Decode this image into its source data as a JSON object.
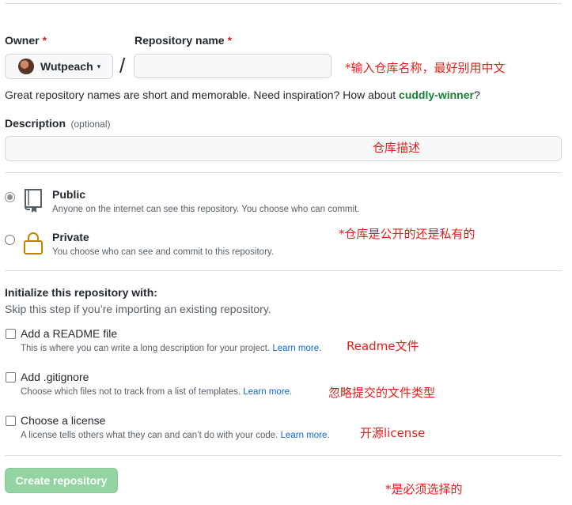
{
  "owner": {
    "label": "Owner",
    "required_mark": "*",
    "value": "Wutpeach",
    "caret": "▾"
  },
  "repo_name": {
    "label": "Repository name",
    "required_mark": "*",
    "value": ""
  },
  "separator": "/",
  "name_hint": {
    "prefix": "Great repository names are short and memorable. Need inspiration? How about ",
    "suggestion": "cuddly-winner",
    "suffix": "?"
  },
  "description": {
    "label": "Description",
    "optional": "(optional)",
    "value": ""
  },
  "visibility": {
    "public": {
      "title": "Public",
      "desc": "Anyone on the internet can see this repository. You choose who can commit.",
      "checked": true
    },
    "private": {
      "title": "Private",
      "desc": "You choose who can see and commit to this repository.",
      "checked": false
    }
  },
  "init": {
    "heading": "Initialize this repository with:",
    "subheading": "Skip this step if you’re importing an existing repository.",
    "readme": {
      "title": "Add a README file",
      "desc": "This is where you can write a long description for your project.",
      "link": "Learn more."
    },
    "gitignore": {
      "title": "Add .gitignore",
      "desc": "Choose which files not to track from a list of templates.",
      "link": "Learn more."
    },
    "license": {
      "title": "Choose a license",
      "desc": "A license tells others what they can and can’t do with your code.",
      "link": "Learn more."
    }
  },
  "create_button": "Create repository",
  "annotations": {
    "repo_name": "*输入仓库名称，最好别用中文",
    "description": "仓库描述",
    "visibility": "*仓库是公开的还是私有的",
    "readme": "Readme文件",
    "gitignore": "忽略提交的文件类型",
    "license": "开源license",
    "required": "*是必须选择的"
  },
  "colors": {
    "accent_green": "#94d3a2",
    "suggestion_green": "#1a7f37",
    "link_blue": "#0969da",
    "annotation_red": "#e0211b",
    "required_red": "#cf222e"
  }
}
